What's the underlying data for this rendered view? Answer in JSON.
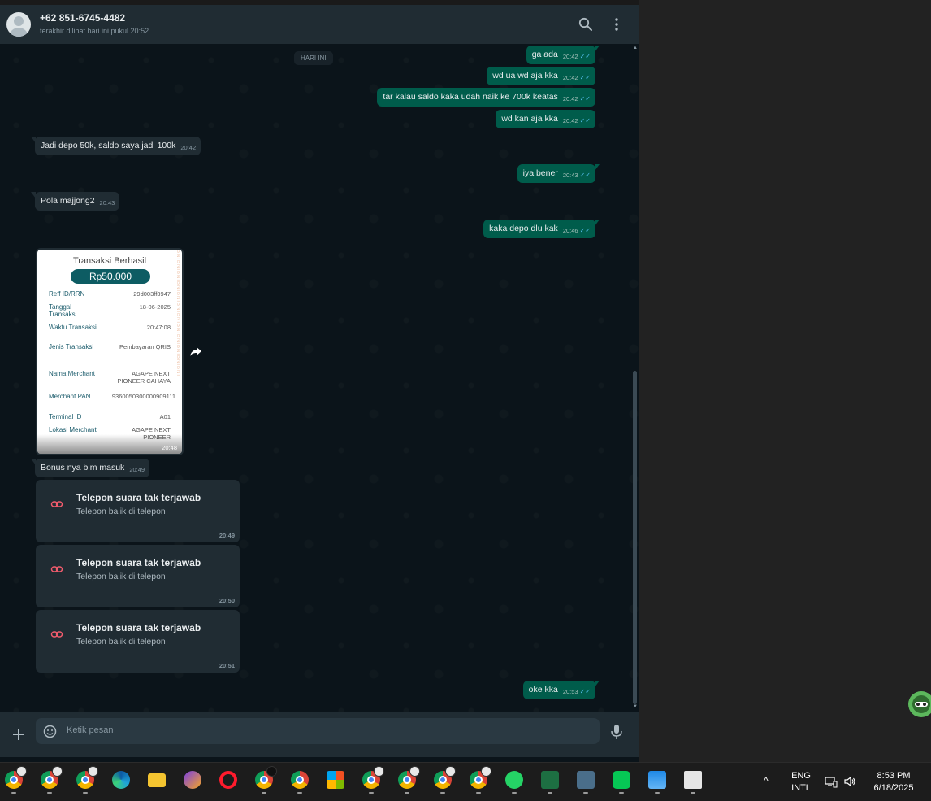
{
  "header": {
    "contact_name": "+62 851-6745-4482",
    "status": "terakhir dilihat hari ini pukul 20:52"
  },
  "chat": {
    "day_label": "HARI INI",
    "messages": [
      {
        "dir": "out",
        "text": "ga ada",
        "time": "20:42"
      },
      {
        "dir": "out",
        "text": "wd ua wd aja kka",
        "time": "20:42"
      },
      {
        "dir": "out",
        "text": "tar kalau saldo kaka udah naik ke 700k keatas",
        "time": "20:42"
      },
      {
        "dir": "out",
        "text": "wd kan aja kka",
        "time": "20:42"
      },
      {
        "dir": "in",
        "text": "Jadi depo 50k, saldo saya jadi 100k",
        "time": "20:42"
      },
      {
        "dir": "out",
        "text": "iya bener",
        "time": "20:43"
      },
      {
        "dir": "in",
        "text": "Pola majjong2",
        "time": "20:43"
      },
      {
        "dir": "out",
        "text": "kaka depo dlu kak",
        "time": "20:46"
      },
      {
        "dir": "in",
        "text": "Bonus nya blm masuk",
        "time": "20:49"
      },
      {
        "dir": "out",
        "text": "oke kka",
        "time": "20:53"
      }
    ],
    "receipt": {
      "title": "Transaksi Berhasil",
      "amount": "Rp50.000",
      "rows": [
        {
          "label": "Reff ID/RRN",
          "value": "29d003ff3947"
        },
        {
          "label": "Tanggal Transaksi",
          "value": "18-06-2025"
        },
        {
          "label": "Waktu Transaksi",
          "value": "20:47:08"
        },
        {
          "label": "Jenis Transaksi",
          "value": "Pembayaran QRIS"
        },
        {
          "label": "Nama Merchant",
          "value": "AGAPE NEXT PIONEER CAHAYA"
        },
        {
          "label": "Merchant PAN",
          "value": "9360050300000909111"
        },
        {
          "label": "Terminal ID",
          "value": "A01"
        },
        {
          "label": "Lokasi Merchant",
          "value": "AGAPE NEXT PIONEER"
        }
      ],
      "watermark": "BNIBNIBNIBNIBNIBNIBNIBNIBNIBNIBNIBNI",
      "time": "20:48"
    },
    "calls": [
      {
        "title": "Telepon suara tak terjawab",
        "subtitle": "Telepon balik di telepon",
        "time": "20:49"
      },
      {
        "title": "Telepon suara tak terjawab",
        "subtitle": "Telepon balik di telepon",
        "time": "20:50"
      },
      {
        "title": "Telepon suara tak terjawab",
        "subtitle": "Telepon balik di telepon",
        "time": "20:51"
      }
    ]
  },
  "composer": {
    "placeholder": "Ketik pesan"
  },
  "taskbar": {
    "apps": [
      "chrome-profile",
      "chrome-new",
      "chrome-profile",
      "edge",
      "file-explorer",
      "vpn",
      "opera",
      "chrome-profile",
      "chrome",
      "microsoft-store",
      "chrome-profile",
      "chrome-profile",
      "chrome-profile",
      "chrome-profile",
      "whatsapp",
      "excel",
      "mail",
      "line",
      "photos",
      "notepad"
    ],
    "language_line1": "ENG",
    "language_line2": "INTL",
    "time": "8:53 PM",
    "date": "6/18/2025"
  },
  "colors": {
    "outgoing_bubble": "#005c4b",
    "incoming_bubble": "#202c33",
    "chat_background": "#0b141a",
    "header": "#202c33",
    "read_ticks": "#53bdeb"
  }
}
